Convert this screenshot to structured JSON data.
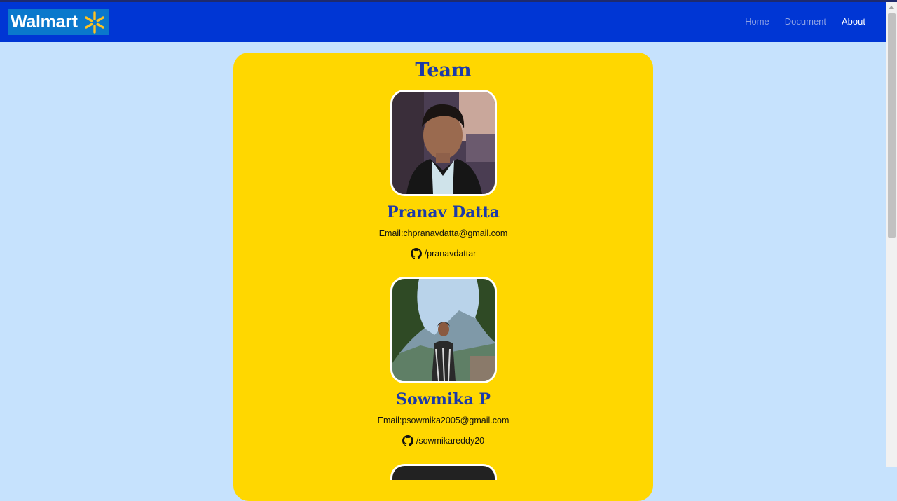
{
  "nav": {
    "brand": "Walmart",
    "links": [
      {
        "label": "Home",
        "active": false
      },
      {
        "label": "Document",
        "active": false
      },
      {
        "label": "About",
        "active": true
      }
    ]
  },
  "page": {
    "title": "Team"
  },
  "members": [
    {
      "name": "Pranav Datta",
      "email": "Email:chpranavdatta@gmail.com",
      "github": "/pranavdattar"
    },
    {
      "name": "Sowmika P",
      "email": "Email:psowmika2005@gmail.com",
      "github": "/sowmikareddy20"
    }
  ],
  "colors": {
    "navbar": "#0036d4",
    "background": "#c6e2fd",
    "card": "#ffd700",
    "heading": "#1c3aa9",
    "spark": "#ffc220"
  },
  "icons": {
    "brand_mark": "walmart-spark-icon",
    "github": "github-icon"
  }
}
